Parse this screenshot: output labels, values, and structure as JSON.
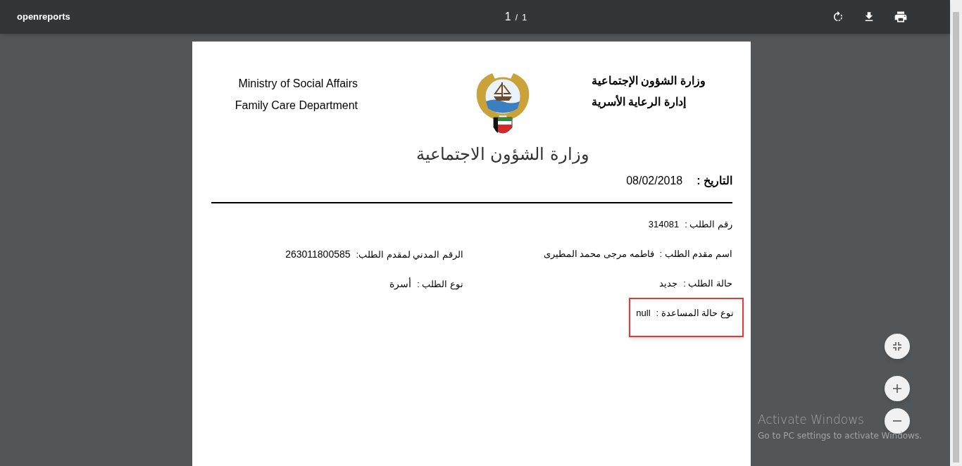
{
  "toolbar": {
    "title": "openreports",
    "page_current": "1",
    "page_separator": "/",
    "page_total": "1"
  },
  "document": {
    "header_en": [
      "Ministry of Social Affairs",
      "Family Care Department"
    ],
    "header_ar": [
      "وزارة الشؤون الإجتماعية",
      "إدارة الرعاية الأسرية"
    ],
    "emblem_caption": "وزارة الشؤون الاجتماعية",
    "date": {
      "label": "التاريخ :",
      "value": "08/02/2018"
    },
    "rows": [
      [
        {
          "label": "رقم الطلب :",
          "value": "314081",
          "highlighted": false
        }
      ],
      [
        {
          "label": "اسم مقدم الطلب :",
          "value": "فاطمه مرجى محمد المطيرى",
          "highlighted": false
        },
        {
          "label": "الرقم المدني لمقدم الطلب:",
          "value": "263011800585",
          "highlighted": false
        }
      ],
      [
        {
          "label": "حالة الطلب :",
          "value": "جديد",
          "highlighted": false
        },
        {
          "label": "نوع الطلب :",
          "value": "أسرة",
          "highlighted": false
        }
      ],
      [
        {
          "label": "نوع حالة المساعدة :",
          "value": "null",
          "highlighted": true
        }
      ]
    ]
  },
  "os_overlay": {
    "title": "Activate Windows",
    "subtitle": "Go to PC settings to activate Windows."
  }
}
